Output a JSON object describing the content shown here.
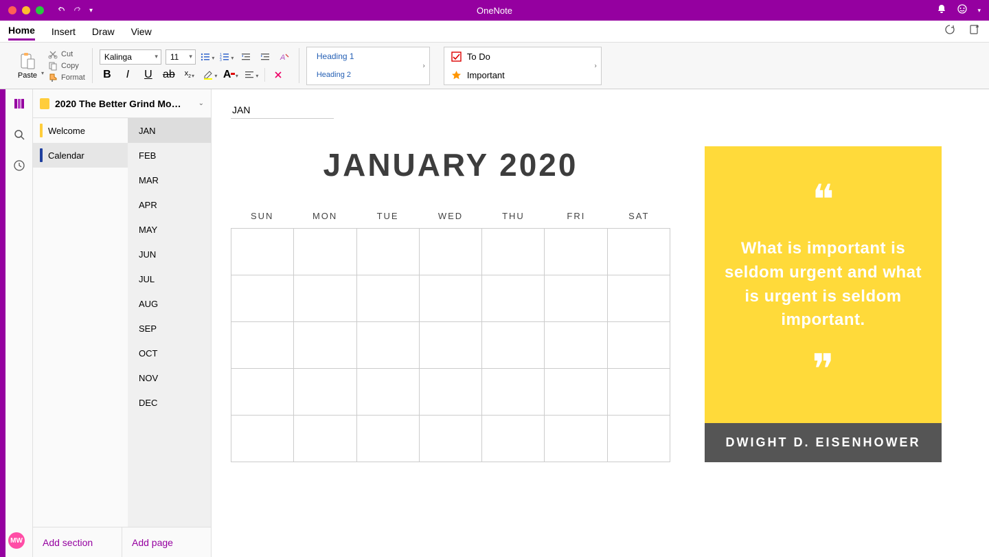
{
  "app_title": "OneNote",
  "menus": [
    "Home",
    "Insert",
    "Draw",
    "View"
  ],
  "active_menu": 0,
  "ribbon": {
    "paste": "Paste",
    "cut": "Cut",
    "copy": "Copy",
    "format": "Format",
    "font_name": "Kalinga",
    "font_size": "11",
    "styles": [
      "Heading 1",
      "Heading 2"
    ],
    "tags": [
      {
        "label": "To Do",
        "icon": "checkbox"
      },
      {
        "label": "Important",
        "icon": "star"
      }
    ]
  },
  "notebook": {
    "title": "2020 The Better Grind Mo…",
    "sections": [
      {
        "name": "Welcome",
        "color": "#ffcd3b"
      },
      {
        "name": "Calendar",
        "color": "#1f3f9e"
      }
    ],
    "active_section": 1,
    "pages": [
      "JAN",
      "FEB",
      "MAR",
      "APR",
      "MAY",
      "JUN",
      "JUL",
      "AUG",
      "SEP",
      "OCT",
      "NOV",
      "DEC"
    ],
    "active_page": 0,
    "add_section": "Add section",
    "add_page": "Add page"
  },
  "page": {
    "title_input": "JAN",
    "calendar_heading": "JANUARY 2020",
    "day_labels": [
      "SUN",
      "MON",
      "TUE",
      "WED",
      "THU",
      "FRI",
      "SAT"
    ],
    "rows": 5
  },
  "quote": {
    "text": "What is important is seldom urgent and what is urgent is seldom important.",
    "author": "DWIGHT D. EISENHOWER"
  },
  "avatar": "MW"
}
